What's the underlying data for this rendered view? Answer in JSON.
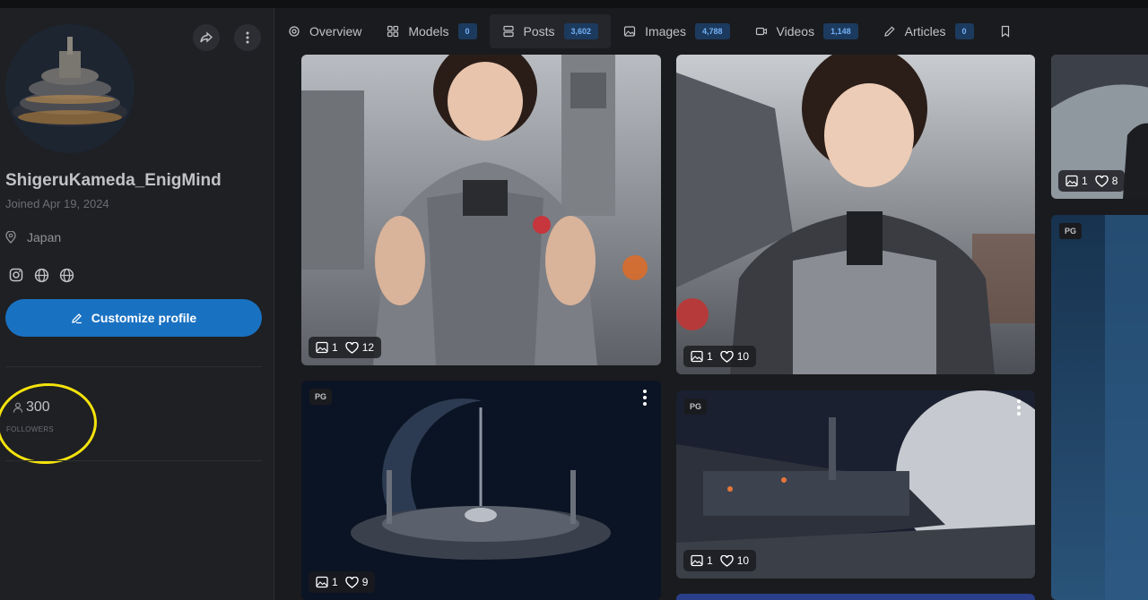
{
  "profile": {
    "username": "ShigeruKameda_EnigMind",
    "joined": "Joined Apr 19, 2024",
    "location": "Japan",
    "customize_label": "Customize profile",
    "followers_count": "300",
    "followers_label": "FOLLOWERS"
  },
  "tabs": [
    {
      "label": "Overview",
      "icon": "gear-icon"
    },
    {
      "label": "Models",
      "count": "0",
      "icon": "models-icon"
    },
    {
      "label": "Posts",
      "count": "3,602",
      "icon": "posts-icon",
      "active": true
    },
    {
      "label": "Images",
      "count": "4,788",
      "icon": "image-icon"
    },
    {
      "label": "Videos",
      "count": "1,148",
      "icon": "video-icon"
    },
    {
      "label": "Articles",
      "count": "0",
      "icon": "pencil-icon"
    }
  ],
  "cards": [
    {
      "images": "1",
      "likes": "12"
    },
    {
      "images": "1",
      "likes": "10"
    },
    {
      "images": "1",
      "likes": "8"
    },
    {
      "badge": "PG",
      "images": "1",
      "likes": "9"
    },
    {
      "badge": "PG",
      "images": "1",
      "likes": "10"
    },
    {
      "badge": "PG"
    }
  ],
  "colors": {
    "accent": "#1971c2",
    "annotation": "#f3e30c",
    "background": "#1a1b1e"
  }
}
